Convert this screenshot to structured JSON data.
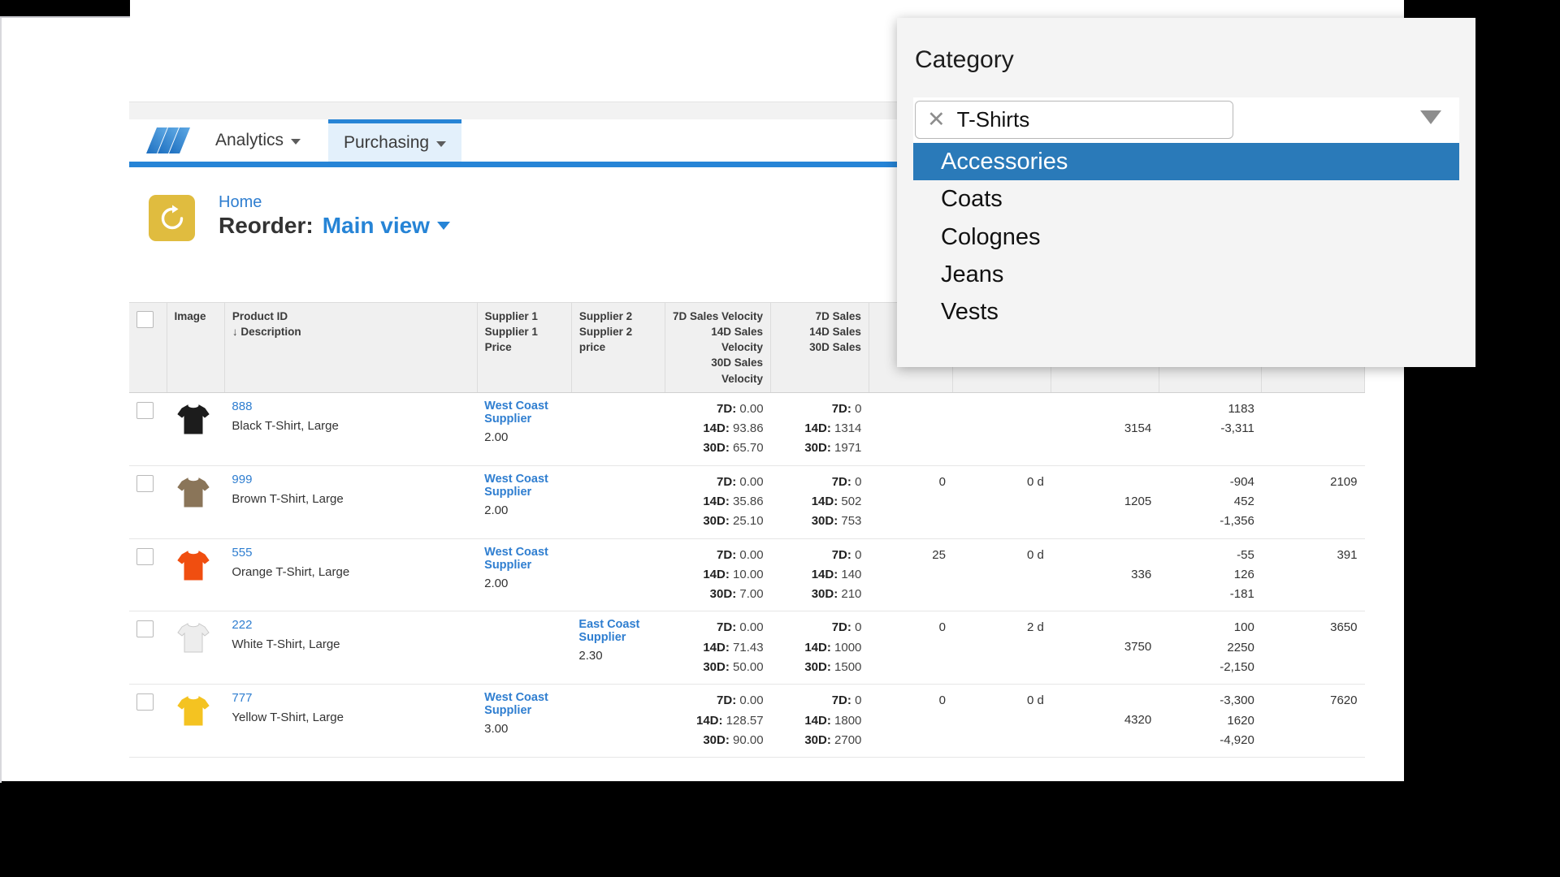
{
  "nav": {
    "logo_icon": "triple-slash-logo",
    "items": [
      {
        "label": "Analytics",
        "caret_icon": "chevron-down-icon"
      },
      {
        "label": "Purchasing",
        "caret_icon": "chevron-down-icon"
      }
    ]
  },
  "header": {
    "icon": "reorder-refresh-icon",
    "breadcrumb": "Home",
    "title": "Reorder:",
    "view_name": "Main view",
    "view_caret_icon": "caret-down-icon"
  },
  "table": {
    "select_all_icon": "checkbox-unchecked-icon",
    "columns": [
      {
        "name": "select",
        "line1": "",
        "line2": ""
      },
      {
        "name": "image",
        "line1": "Image",
        "line2": ""
      },
      {
        "name": "product",
        "line1": "Product ID",
        "line2": "↓ Description"
      },
      {
        "name": "supplier1",
        "line1": "Supplier 1",
        "line2": "Supplier 1 Price"
      },
      {
        "name": "supplier2",
        "line1": "Supplier 2",
        "line2": "Supplier 2 price"
      },
      {
        "name": "sales_velocity",
        "line1": "7D Sales Velocity",
        "line2": "14D Sales Velocity",
        "line3": "30D Sales Velocity"
      },
      {
        "name": "sales",
        "line1": "7D Sales",
        "line2": "14D Sales",
        "line3": "30D Sales"
      }
    ],
    "rows": [
      {
        "checkbox": "checkbox-unchecked-icon",
        "shirt_color": "#1c1c1c",
        "shirt_icon": "tshirt-icon",
        "product_id": "888",
        "description": "Black T-Shirt, Large",
        "supplier1_name": "West Coast Supplier",
        "supplier1_price": "2.00",
        "supplier2_name": "",
        "supplier2_price": "",
        "velocity": {
          "d7": "0.00",
          "d14": "93.86",
          "d30": "65.70"
        },
        "sales": {
          "d7": "0",
          "d14": "1314",
          "d30": "1971"
        },
        "col_a": "",
        "col_b": "",
        "col_c": "3154",
        "col_d1": "",
        "col_d2": "1183",
        "col_d3": "-3,311",
        "col_e": ""
      },
      {
        "checkbox": "checkbox-unchecked-icon",
        "shirt_color": "#8a7559",
        "shirt_icon": "tshirt-icon",
        "product_id": "999",
        "description": "Brown T-Shirt, Large",
        "supplier1_name": "West Coast Supplier",
        "supplier1_price": "2.00",
        "supplier2_name": "",
        "supplier2_price": "",
        "velocity": {
          "d7": "0.00",
          "d14": "35.86",
          "d30": "25.10"
        },
        "sales": {
          "d7": "0",
          "d14": "502",
          "d30": "753"
        },
        "col_a": "0",
        "col_b": "0 d",
        "col_c": "1205",
        "col_d1": "-904",
        "col_d2": "452",
        "col_d3": "-1,356",
        "col_e": "2109"
      },
      {
        "checkbox": "checkbox-unchecked-icon",
        "shirt_color": "#f04e10",
        "shirt_icon": "tshirt-icon",
        "product_id": "555",
        "description": "Orange T-Shirt, Large",
        "supplier1_name": "West Coast Supplier",
        "supplier1_price": "2.00",
        "supplier2_name": "",
        "supplier2_price": "",
        "velocity": {
          "d7": "0.00",
          "d14": "10.00",
          "d30": "7.00"
        },
        "sales": {
          "d7": "0",
          "d14": "140",
          "d30": "210"
        },
        "col_a": "25",
        "col_b": "0 d",
        "col_c": "336",
        "col_d1": "-55",
        "col_d2": "126",
        "col_d3": "-181",
        "col_e": "391"
      },
      {
        "checkbox": "checkbox-unchecked-icon",
        "shirt_color": "#ededed",
        "shirt_icon": "tshirt-icon",
        "product_id": "222",
        "description": "White T-Shirt, Large",
        "supplier1_name": "",
        "supplier1_price": "",
        "supplier2_name": "East Coast Supplier",
        "supplier2_price": "2.30",
        "velocity": {
          "d7": "0.00",
          "d14": "71.43",
          "d30": "50.00"
        },
        "sales": {
          "d7": "0",
          "d14": "1000",
          "d30": "1500"
        },
        "col_a": "0",
        "col_b": "2 d",
        "col_c": "3750",
        "col_d1": "100",
        "col_d2": "2250",
        "col_d3": "-2,150",
        "col_e": "3650"
      },
      {
        "checkbox": "checkbox-unchecked-icon",
        "shirt_color": "#f4c321",
        "shirt_icon": "tshirt-icon",
        "product_id": "777",
        "description": "Yellow T-Shirt, Large",
        "supplier1_name": "West Coast Supplier",
        "supplier1_price": "3.00",
        "supplier2_name": "",
        "supplier2_price": "",
        "velocity": {
          "d7": "0.00",
          "d14": "128.57",
          "d30": "90.00"
        },
        "sales": {
          "d7": "0",
          "d14": "1800",
          "d30": "2700"
        },
        "col_a": "0",
        "col_b": "0 d",
        "col_c": "4320",
        "col_d1": "-3,300",
        "col_d2": "1620",
        "col_d3": "-4,920",
        "col_e": "7620"
      }
    ],
    "labels": {
      "d7": "7D:",
      "d14": "14D:",
      "d30": "30D:"
    }
  },
  "category_panel": {
    "title": "Category",
    "selected_token": "T-Shirts",
    "remove_icon": "close-x-icon",
    "dropdown_caret_icon": "caret-down-icon",
    "options": [
      {
        "label": "Accessories",
        "selected": true
      },
      {
        "label": "Coats",
        "selected": false
      },
      {
        "label": "Colognes",
        "selected": false
      },
      {
        "label": "Jeans",
        "selected": false
      },
      {
        "label": "Vests",
        "selected": false
      }
    ]
  },
  "colors": {
    "accent_blue": "#2684d6",
    "link_blue": "#2f7ed0",
    "highlight_blue": "#2a7ab9",
    "reorder_icon_gold": "#e0bc3f"
  }
}
